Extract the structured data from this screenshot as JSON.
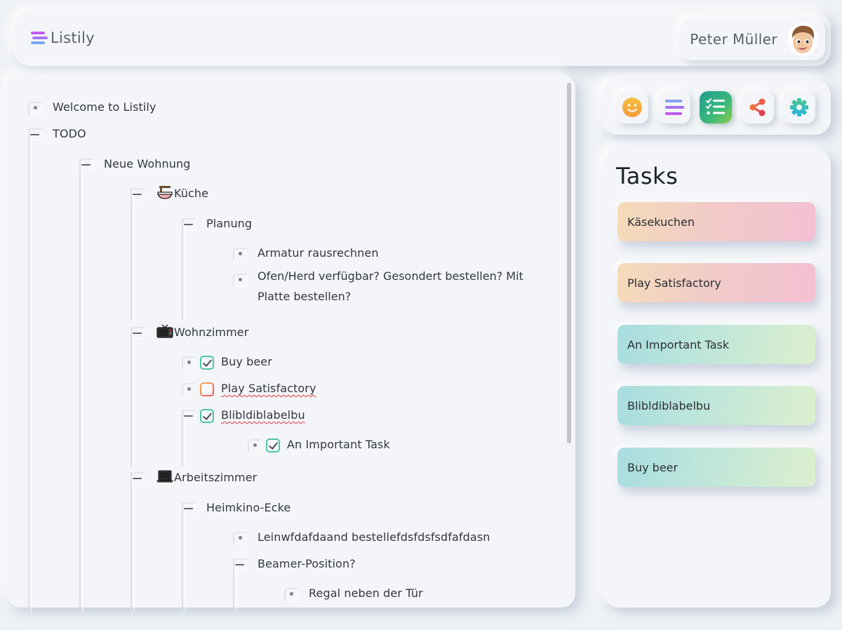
{
  "header": {
    "app_name": "Listily",
    "logo_icon": "list-lines-icon",
    "user_name": "Peter Müller",
    "avatar_icon": "memoji-avatar"
  },
  "tree": {
    "items": [
      {
        "label": "Welcome to Listily",
        "type": "leaf",
        "depth": 0
      },
      {
        "label": "TODO",
        "type": "expanded",
        "depth": 0
      },
      {
        "label": "Neue Wohnung",
        "type": "expanded",
        "depth": 1
      },
      {
        "label": "Küche",
        "emoji": "noodle-bowl-icon",
        "type": "expanded",
        "depth": 2
      },
      {
        "label": "Planung",
        "type": "expanded",
        "depth": 3
      },
      {
        "label": "Armatur rausrechnen",
        "type": "leaf",
        "depth": 4
      },
      {
        "label": "Ofen/Herd verfügbar? Gesondert bestellen? Mit",
        "label2": "Platte bestellen?",
        "type": "leaf",
        "depth": 4
      },
      {
        "label": "Wohnzimmer",
        "emoji": "television-icon",
        "type": "expanded",
        "depth": 2
      },
      {
        "label": "Buy beer",
        "type": "leaf",
        "depth": 3,
        "checkbox": "checked"
      },
      {
        "label": "Play Satisfactory",
        "type": "leaf",
        "depth": 3,
        "checkbox": "unchecked"
      },
      {
        "label": "Blibldiblabelbu",
        "type": "expanded",
        "depth": 3,
        "checkbox": "checked"
      },
      {
        "label": "An Important Task",
        "type": "leaf",
        "depth": 4,
        "checkbox": "checked"
      },
      {
        "label": "Arbeitszimmer",
        "emoji": "laptop-icon",
        "type": "expanded",
        "depth": 2
      },
      {
        "label": "Heimkino-Ecke",
        "type": "expanded",
        "depth": 3
      },
      {
        "label": "Leinwfdafdaand bestellefdsfdsfsdfafdasn",
        "type": "leaf",
        "depth": 4
      },
      {
        "label": "Beamer-Position?",
        "type": "expanded",
        "depth": 4
      },
      {
        "label": "Regal neben der Tür",
        "type": "leaf",
        "depth": 5
      }
    ]
  },
  "toolbar": {
    "buttons": [
      {
        "name": "emoji-button",
        "icon": "smiley-icon",
        "active": false
      },
      {
        "name": "list-view-button",
        "icon": "list-lines-icon",
        "active": false
      },
      {
        "name": "tasks-button",
        "icon": "checklist-icon",
        "active": true
      },
      {
        "name": "share-button",
        "icon": "share-icon",
        "active": false
      },
      {
        "name": "settings-button",
        "icon": "gear-icon",
        "active": false
      }
    ]
  },
  "tasks": {
    "title": "Tasks",
    "cards": [
      {
        "label": "Käsekuchen",
        "tone": "warm"
      },
      {
        "label": "Play Satisfactory",
        "tone": "warm"
      },
      {
        "label": "An Important Task",
        "tone": "cool"
      },
      {
        "label": "Blibldiblabelbu",
        "tone": "cool"
      },
      {
        "label": "Buy beer",
        "tone": "cool"
      }
    ]
  },
  "colors": {
    "background": "#eef1f5",
    "surface": "#f3f5f8",
    "accent_green": "#3cb97a",
    "logo_purple": "#a874ee",
    "check_border": "#4fc3a8",
    "spellcheck_red": "#e03a3a"
  }
}
